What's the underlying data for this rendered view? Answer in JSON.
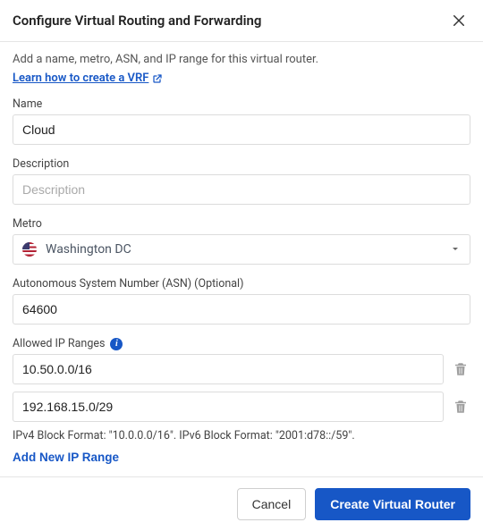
{
  "header": {
    "title": "Configure Virtual Routing and Forwarding"
  },
  "intro": "Add a name, metro, ASN, and IP range for this virtual router.",
  "learn_link": "Learn how to create a VRF",
  "form": {
    "name": {
      "label": "Name",
      "value": "Cloud"
    },
    "description": {
      "label": "Description",
      "placeholder": "Description",
      "value": ""
    },
    "metro": {
      "label": "Metro",
      "selected": "Washington DC"
    },
    "asn": {
      "label": "Autonomous System Number (ASN) (Optional)",
      "value": "64600"
    },
    "ip_ranges": {
      "label": "Allowed IP Ranges",
      "items": [
        "10.50.0.0/16",
        "192.168.15.0/29"
      ],
      "format_hint": "IPv4 Block Format: \"10.0.0.0/16\". IPv6 Block Format: \"2001:d78::/59\".",
      "add_label": "Add New IP Range"
    }
  },
  "footer": {
    "cancel": "Cancel",
    "submit": "Create Virtual Router"
  }
}
